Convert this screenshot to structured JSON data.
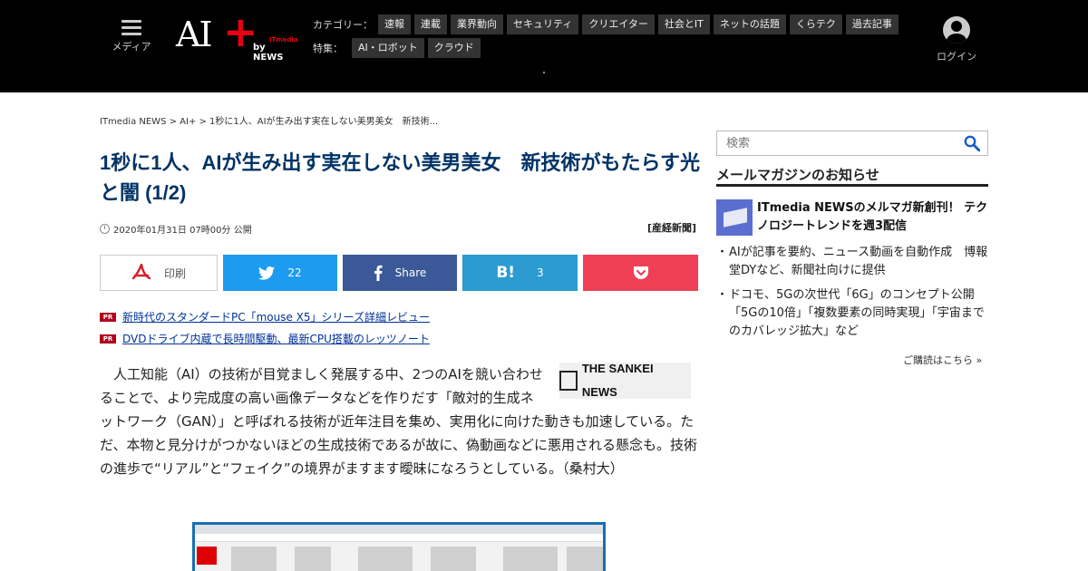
{
  "header": {
    "menu_label": "メディア",
    "logo": {
      "main": "AI",
      "plus": "+",
      "by": "by NEWS",
      "itmedia": "ITmedia"
    },
    "category_caption": "カテゴリー：",
    "categories": [
      "速報",
      "連載",
      "業界動向",
      "セキュリティ",
      "クリエイター",
      "社会とIT",
      "ネットの話題",
      "くらテク",
      "過去記事"
    ],
    "feature_caption": "特集：",
    "features": [
      "AI・ロボット",
      "クラウド"
    ],
    "login_label": "ログイン"
  },
  "breadcrumb": "ITmedia NEWS > AI+ > 1秒に1人、AIが生み出す実在しない美男美女　新技術...",
  "article": {
    "title": "1秒に1人、AIが生み出す実在しない美男美女　新技術がもたらす光と闇 (1/2)",
    "date": "2020年01月31日 07時00分 公開",
    "source": "[産経新聞]",
    "share": {
      "print_label": "印刷",
      "twitter_count": "22",
      "facebook_label": "Share",
      "hatena_count": "3"
    },
    "pr_badge": "PR",
    "pr_links": [
      "新時代のスタンダードPC「mouse X5」シリーズ詳細レビュー",
      "DVDドライブ内蔵で長時間駆動、最新CPU搭載のレッツノート"
    ],
    "sankei_logo": "THE SANKEI NEWS",
    "body": "　人工知能（AI）の技術が目覚ましく発展する中、2つのAIを競い合わせることで、より完成度の高い画像データなどを作りだす「敵対的生成ネットワーク（GAN）」と呼ばれる技術が近年注目を集め、実用化に向けた動きも加速している。ただ、本物と見分けがつかないほどの生成技術であるが故に、偽動画などに悪用される懸念も。技術の進歩で“リアル”と“フェイク”の境界がますます曖昧になろうとしている。（桑村大）"
  },
  "sidebar": {
    "search_placeholder": "検索",
    "newsletter_title": "メールマガジンのお知らせ",
    "featured": "ITmedia NEWSのメルマガ新創刊！ テクノロジートレンドを週3配信",
    "items": [
      "AIが記事を要約、ニュース動画を自動作成　博報堂DYなど、新聞社向けに提供",
      "ドコモ、5Gの次世代「6G」のコンセプト公開　「5Gの10倍」「複数要素の同時実現」「宇宙までのカバレッジ拡大」など"
    ],
    "more_link": "ご購読はこちら »"
  },
  "colors": {
    "header_bg": "#000000",
    "title": "#003366",
    "twitter": "#1d9bf0",
    "facebook": "#3b5998",
    "hatena": "#2c9bd0",
    "pocket": "#ef4056",
    "logo_accent": "#e60012"
  },
  "icons": [
    "menu-icon",
    "user-avatar-icon",
    "clock-icon",
    "pdf-icon",
    "twitter-icon",
    "facebook-icon",
    "hatena-icon",
    "pocket-icon",
    "search-icon"
  ]
}
